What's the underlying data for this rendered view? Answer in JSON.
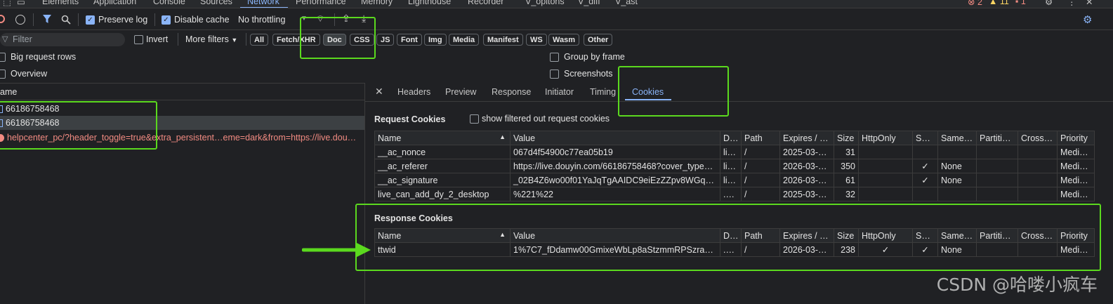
{
  "tabs": [
    "Elements",
    "Application",
    "Console",
    "Sources",
    "Network",
    "Performance",
    "Memory",
    "Lighthouse",
    "Recorder",
    "V_opitons",
    "V_diff",
    "V_ast"
  ],
  "active_tab": "Network",
  "issues": {
    "errors": "2",
    "warnings": "11",
    "info": "1"
  },
  "toolbar": {
    "preserve_log": "Preserve log",
    "disable_cache": "Disable cache",
    "throttling": "No throttling"
  },
  "filter": {
    "placeholder": "Filter",
    "invert": "Invert",
    "more_filters": "More filters",
    "chips": [
      "All",
      "Fetch/XHR",
      "Doc",
      "CSS",
      "JS",
      "Font",
      "Img",
      "Media",
      "Manifest",
      "WS",
      "Wasm",
      "Other"
    ],
    "active_chip": "Doc"
  },
  "options": {
    "big_rows": "Big request rows",
    "overview": "Overview",
    "group_by_frame": "Group by frame",
    "screenshots": "Screenshots"
  },
  "list": {
    "header": "ame",
    "requests": [
      {
        "name": "66186758468",
        "error": false
      },
      {
        "name": "66186758468",
        "error": false
      },
      {
        "name": "helpcenter_pc/?header_toggle=true&extra_persistent…eme=dark&from=https://live.dou…",
        "error": true
      }
    ]
  },
  "details": {
    "tabs": [
      "Headers",
      "Preview",
      "Response",
      "Initiator",
      "Timing",
      "Cookies"
    ],
    "active_tab": "Cookies",
    "request_title": "Request Cookies",
    "show_filtered": "show filtered out request cookies",
    "response_title": "Response Cookies",
    "columns": [
      "Name",
      "Value",
      "D…",
      "Path",
      "Expires / …",
      "Size",
      "HttpOnly",
      "Se…",
      "Same…",
      "Partiti…",
      "Cross …",
      "Priority"
    ],
    "request_cookies": [
      [
        "__ac_nonce",
        "067d4f54900c77ea05b19",
        "li…",
        "/",
        "2025-03-…",
        "31",
        "",
        "",
        "",
        "",
        "",
        "Medium"
      ],
      [
        "__ac_referer",
        "https://live.douyin.com/66186758468?cover_type…",
        "li…",
        "/",
        "2026-03-…",
        "350",
        "",
        "✓",
        "None",
        "",
        "",
        "Medium"
      ],
      [
        "__ac_signature",
        "_02B4Z6wo00f01YaJqTgAAIDC9eiEzZZpv8WGqa…",
        "li…",
        "/",
        "2026-03-…",
        "61",
        "",
        "✓",
        "None",
        "",
        "",
        "Medium"
      ],
      [
        "live_can_add_dy_2_desktop",
        "%221%22",
        ".d…",
        "/",
        "2025-03-…",
        "32",
        "",
        "",
        "",
        "",
        "",
        "Medium"
      ]
    ],
    "response_cookies": [
      [
        "ttwid",
        "1%7C7_fDdamw00GmixeWbLp8aStzmmRPSzrapE…",
        ".d…",
        "/",
        "2026-03-…",
        "238",
        "✓",
        "✓",
        "None",
        "",
        "",
        "Medium"
      ]
    ]
  },
  "watermark": "CSDN @哈喽小疯车",
  "colors": {
    "highlight": "#5bd91e",
    "accent": "#8ab4f8",
    "error": "#f28b82"
  }
}
